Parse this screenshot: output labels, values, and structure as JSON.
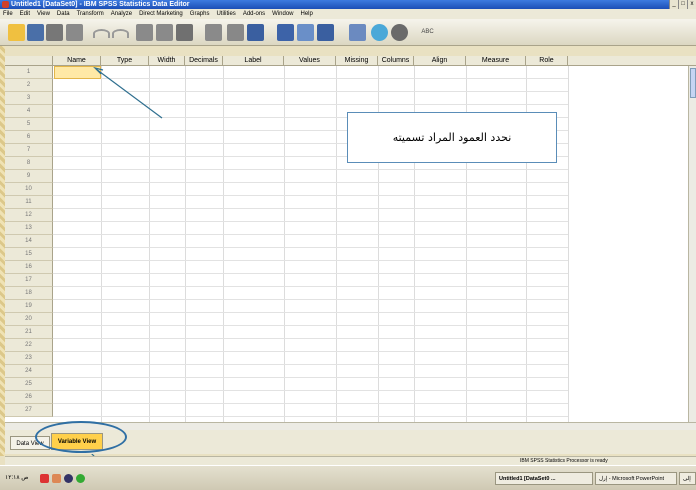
{
  "window": {
    "title": "Untitled1 [DataSet0] - IBM SPSS Statistics Data Editor"
  },
  "window_buttons": [
    "_",
    "□",
    "x"
  ],
  "menu": [
    "File",
    "Edit",
    "View",
    "Data",
    "Transform",
    "Analyze",
    "Direct Marketing",
    "Graphs",
    "Utilities",
    "Add-ons",
    "Window",
    "Help"
  ],
  "toolbar": {
    "icons": [
      "open-folder-icon",
      "save-icon",
      "print-icon",
      "dialog-recall-icon",
      "undo-icon",
      "redo-icon",
      "goto-case-icon",
      "goto-variable-icon",
      "variables-icon",
      "find-icon",
      "insert-cases-icon",
      "insert-variable-icon",
      "split-file-icon",
      "weight-cases-icon",
      "select-cases-icon",
      "value-labels-icon",
      "use-sets-icon",
      "show-all-icon",
      "spell-check-icon"
    ],
    "spell_label": "ABC"
  },
  "grid": {
    "columns": [
      "Name",
      "Type",
      "Width",
      "Decimals",
      "Label",
      "Values",
      "Missing",
      "Columns",
      "Align",
      "Measure",
      "Role"
    ],
    "rows": [
      "1",
      "2",
      "3",
      "4",
      "5",
      "6",
      "7",
      "8",
      "9",
      "10",
      "11",
      "12",
      "13",
      "14",
      "15",
      "16",
      "17",
      "18",
      "19",
      "20",
      "21",
      "22",
      "23",
      "24",
      "25",
      "26",
      "27"
    ]
  },
  "callout": {
    "text": "نحدد العمود المراد تسميته"
  },
  "tabs": {
    "data_view": "Data View",
    "variable_view": "Variable View"
  },
  "status": {
    "text": "IBM SPSS Statistics Processor is ready"
  },
  "taskbar": {
    "clock": "ص ١٢:١٨",
    "items": [
      "Untitled1 [DataSet0 ...",
      "إرل - Microsoft PowerPoint",
      "إلى"
    ]
  },
  "colors": {
    "selected_cell": "#ffe9a6",
    "active_tab": "#ffd04a",
    "callout_border": "#5a8db8"
  }
}
